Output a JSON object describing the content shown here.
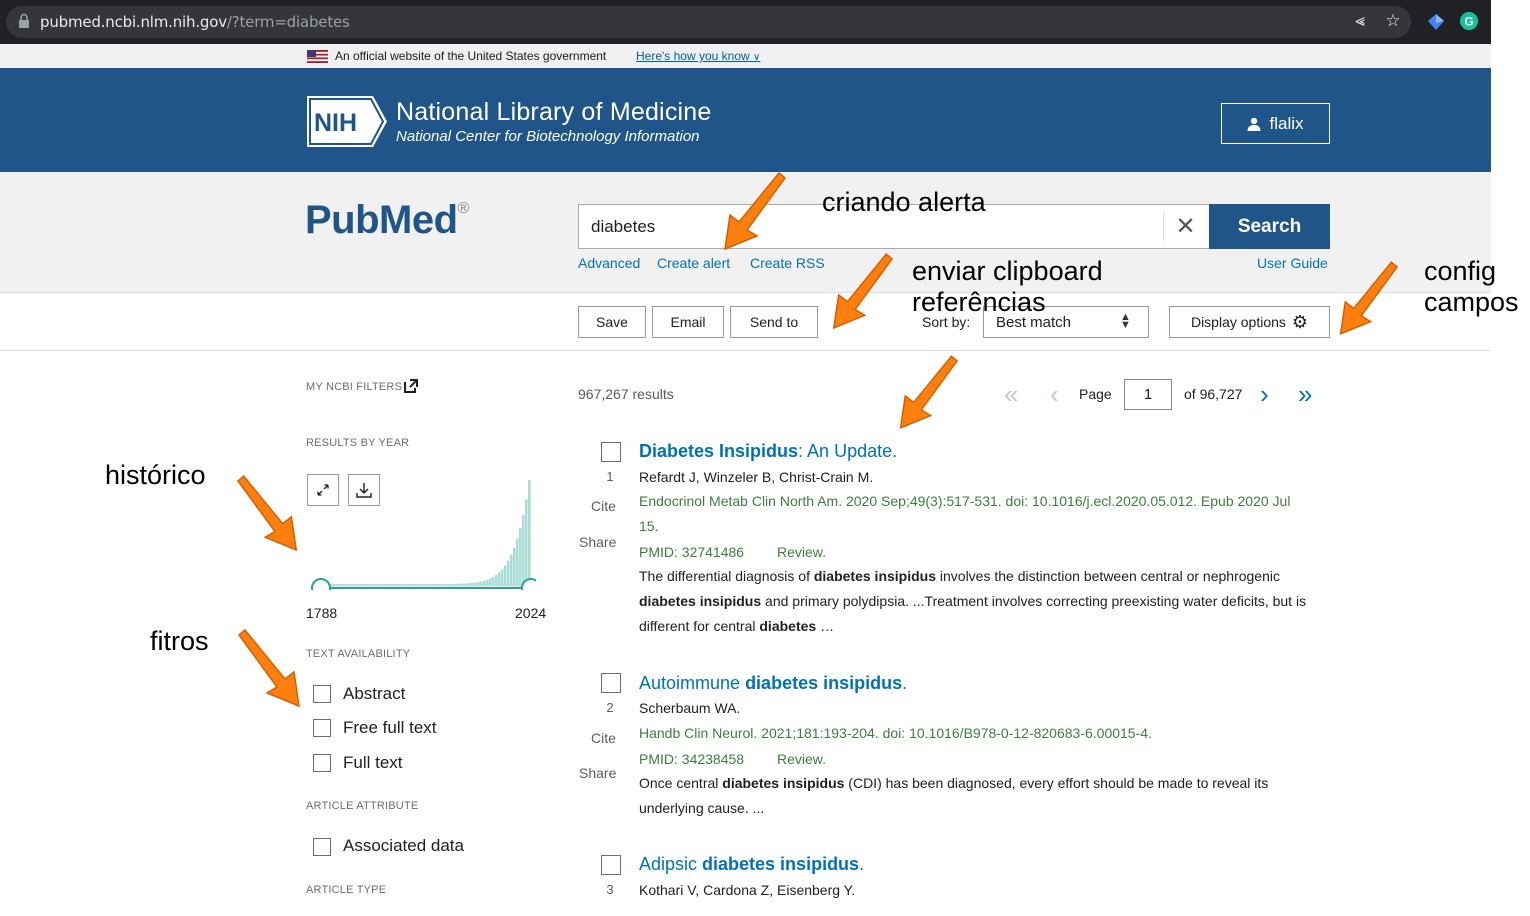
{
  "browser": {
    "url_host": "pubmed.ncbi.nlm.nih.gov",
    "url_path": "/?term=diabetes"
  },
  "gov_banner": {
    "text": "An official website of the United States government",
    "link": "Here's how you know"
  },
  "nlm_header": {
    "logo_text": "NIH",
    "title": "National Library of Medicine",
    "subtitle": "National Center for Biotechnology Information",
    "user": "flalix"
  },
  "search": {
    "logo": "PubMed",
    "query": "diabetes",
    "button": "Search",
    "links": {
      "advanced": "Advanced",
      "create_alert": "Create alert",
      "create_rss": "Create RSS",
      "user_guide": "User Guide"
    }
  },
  "toolbar": {
    "save": "Save",
    "email": "Email",
    "send_to": "Send to",
    "sort_label": "Sort by:",
    "sort_value": "Best match",
    "display_options": "Display options"
  },
  "sidebar": {
    "my_ncbi_filters": "MY NCBI FILTERS",
    "results_by_year": "RESULTS BY YEAR",
    "year_start": "1788",
    "year_end": "2024",
    "text_availability": "TEXT AVAILABILITY",
    "filters_text": [
      "Abstract",
      "Free full text",
      "Full text"
    ],
    "article_attribute": "ARTICLE ATTRIBUTE",
    "filters_attribute": [
      "Associated data"
    ],
    "article_type": "ARTICLE TYPE"
  },
  "results_header": {
    "count": "967,267 results",
    "page_label": "Page",
    "page_value": "1",
    "of_total": "of 96,727"
  },
  "results": [
    {
      "num": "1",
      "title_a": "Diabetes Insipidus",
      "title_b": ": An Update.",
      "authors": "Refardt J, Winzeler B, Christ-Crain M.",
      "citation": "Endocrinol Metab Clin North Am. 2020 Sep;49(3):517-531. doi: 10.1016/j.ecl.2020.05.012. Epub 2020 Jul 15.",
      "pmid": "PMID: 32741486",
      "type": "Review.",
      "snippet_parts": [
        "The differential diagnosis of ",
        "diabetes insipidus",
        " involves the distinction between central or nephrogenic ",
        "diabetes insipidus",
        " and primary polydipsia. ...Treatment involves correcting preexisting water deficits, but is different for central ",
        "diabetes",
        " …"
      ],
      "cite": "Cite",
      "share": "Share"
    },
    {
      "num": "2",
      "title_a": "Autoimmune ",
      "title_b": "diabetes insipidus",
      "title_c": ".",
      "authors": "Scherbaum WA.",
      "citation": "Handb Clin Neurol. 2021;181:193-204. doi: 10.1016/B978-0-12-820683-6.00015-4.",
      "pmid": "PMID: 34238458",
      "type": "Review.",
      "snippet_parts": [
        "Once central ",
        "diabetes insipidus",
        " (CDI) has been diagnosed, every effort should be made to reveal its underlying cause. ..."
      ],
      "cite": "Cite",
      "share": "Share"
    },
    {
      "num": "3",
      "title_a": "Adipsic ",
      "title_b": "diabetes insipidus",
      "title_c": ".",
      "authors": "Kothari V, Cardona Z, Eisenberg Y."
    }
  ],
  "annotations": {
    "criando_alerta": "criando alerta",
    "enviar_line1": "enviar clipboard",
    "enviar_line2": "referências",
    "config_line1": "config",
    "config_line2": "campos",
    "historico": "histórico",
    "fitros": "fitros"
  },
  "colors": {
    "nlm_blue": "#20558a",
    "link_blue": "#0071bc",
    "citation_green": "#3f7d3f",
    "annotation_arrow": "#ff7f0e",
    "histogram": "#a8dcd6",
    "slider": "#2aa198"
  }
}
